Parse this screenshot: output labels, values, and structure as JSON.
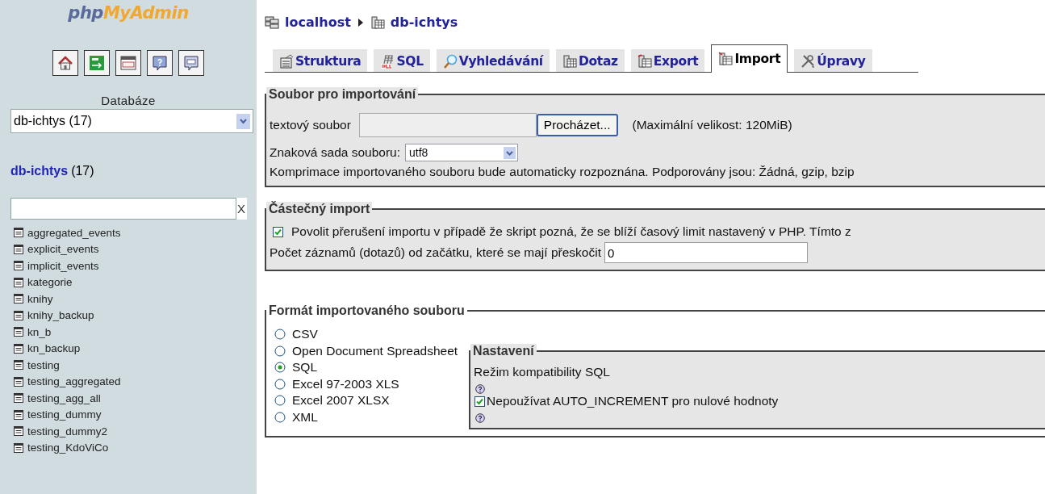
{
  "sidebar": {
    "logo": {
      "first": "php",
      "second": "MyAdmin"
    },
    "db_label": "Databáze",
    "db_select": {
      "value": "db-ichtys (17)"
    },
    "db_heading": {
      "name": "db-ichtys",
      "count": "(17)"
    },
    "filter": {
      "clear": "X"
    },
    "tables": [
      "aggregated_events",
      "explicit_events",
      "implicit_events",
      "kategorie",
      "knihy",
      "knihy_backup",
      "kn_b",
      "kn_backup",
      "testing",
      "testing_aggregated",
      "testing_agg_all",
      "testing_dummy",
      "testing_dummy2",
      "testing_KdoViCo"
    ]
  },
  "breadcrumb": [
    {
      "label": "localhost"
    },
    {
      "label": "db-ichtys"
    }
  ],
  "tabs": [
    {
      "label": "Struktura",
      "selected": false
    },
    {
      "label": "SQL",
      "selected": false
    },
    {
      "label": "Vyhledávání",
      "selected": false
    },
    {
      "label": "Dotaz",
      "selected": false
    },
    {
      "label": "Export",
      "selected": false
    },
    {
      "label": "Import",
      "selected": true
    },
    {
      "label": "Úpravy",
      "selected": false
    }
  ],
  "file_section": {
    "legend": "Soubor pro importování",
    "file_label": "textový soubor",
    "browse_button": "Procházet...",
    "max_size": "(Maximální velikost: 120MiB)",
    "charset_label": "Znaková sada souboru:",
    "charset_value": "utf8",
    "compression_note": "Komprimace importovaného souboru bude automaticky rozpoznána. Podporovány jsou: Žádná, gzip, bzip"
  },
  "partial_section": {
    "legend": "Částečný import",
    "allow_interrupt": {
      "label": "Povolit přerušení importu v případě že skript pozná, že se blíží časový limit nastavený v PHP. Tímto z",
      "checked": true
    },
    "skip_label": "Počet záznamů (dotazů) od začátku, které se mají přeskočit",
    "skip_value": "0"
  },
  "format_section": {
    "legend": "Formát importovaného souboru",
    "formats": [
      {
        "label": "CSV",
        "selected": false
      },
      {
        "label": "Open Document Spreadsheet",
        "selected": false
      },
      {
        "label": "SQL",
        "selected": true
      },
      {
        "label": "Excel 97-2003 XLS",
        "selected": false
      },
      {
        "label": "Excel 2007 XLSX",
        "selected": false
      },
      {
        "label": "XML",
        "selected": false
      }
    ],
    "options": {
      "legend": "Nastavení",
      "compat_label": "Režim kompatibility SQL",
      "no_auto_increment": {
        "label": "Nepoužívat AUTO_INCREMENT pro nulové hodnoty",
        "checked": true
      }
    }
  }
}
